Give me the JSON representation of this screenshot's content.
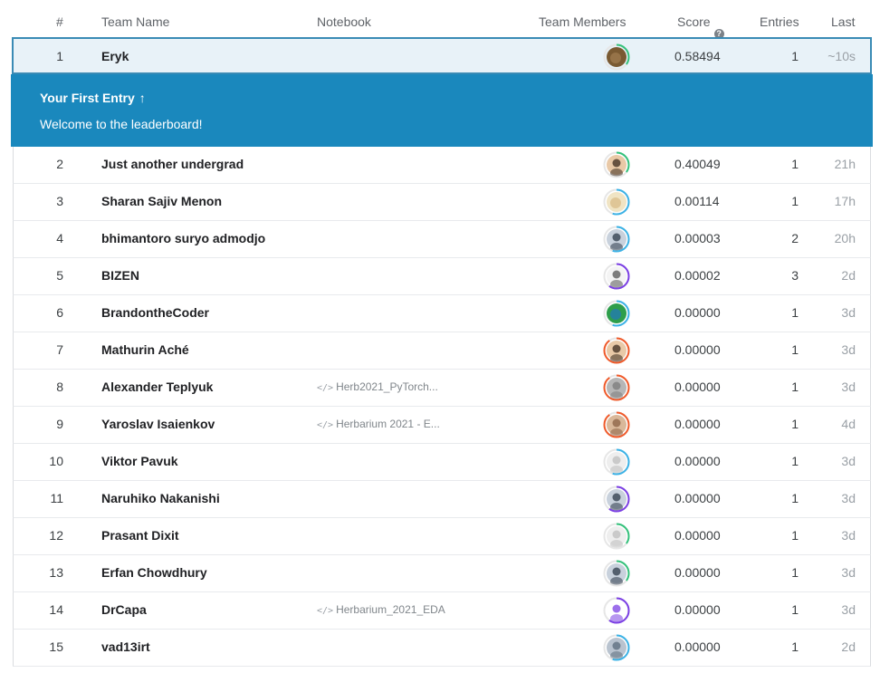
{
  "columns": {
    "rank": "#",
    "team": "Team Name",
    "notebook": "Notebook",
    "members": "Team Members",
    "score": "Score",
    "entries": "Entries",
    "last": "Last"
  },
  "banner": {
    "title": "Your First Entry",
    "message": "Welcome to the leaderboard!",
    "background": "#1a88bd"
  },
  "accent": {
    "green": "#34c17b",
    "blue": "#3bb2e6",
    "purple": "#7b3fe4",
    "orange": "#f05a2a",
    "highlight_border": "#3a8bb5",
    "highlight_bg": "#e8f2f8"
  },
  "rows": [
    {
      "rank": "1",
      "team": "Eryk",
      "notebook": "",
      "score": "0.58494",
      "entries": "1",
      "last": "~10s",
      "ring": "green",
      "avatar": "brown"
    },
    {
      "rank": "2",
      "team": "Just another undergrad",
      "notebook": "",
      "score": "0.40049",
      "entries": "1",
      "last": "21h",
      "ring": "green",
      "avatar": "person"
    },
    {
      "rank": "3",
      "team": "Sharan Sajiv Menon",
      "notebook": "",
      "score": "0.00114",
      "entries": "1",
      "last": "17h",
      "ring": "blue",
      "avatar": "sand"
    },
    {
      "rank": "4",
      "team": "bhimantoro suryo admodjo",
      "notebook": "",
      "score": "0.00003",
      "entries": "2",
      "last": "20h",
      "ring": "blue",
      "avatar": "person-dark"
    },
    {
      "rank": "5",
      "team": "BIZEN",
      "notebook": "",
      "score": "0.00002",
      "entries": "3",
      "last": "2d",
      "ring": "purple",
      "avatar": "person-light"
    },
    {
      "rank": "6",
      "team": "BrandontheCoder",
      "notebook": "",
      "score": "0.00000",
      "entries": "1",
      "last": "3d",
      "ring": "blue",
      "avatar": "green"
    },
    {
      "rank": "7",
      "team": "Mathurin Aché",
      "notebook": "",
      "score": "0.00000",
      "entries": "1",
      "last": "3d",
      "ring": "orange",
      "avatar": "person"
    },
    {
      "rank": "8",
      "team": "Alexander Teplyuk",
      "notebook": "Herb2021_PyTorch...",
      "score": "0.00000",
      "entries": "1",
      "last": "3d",
      "ring": "orange",
      "avatar": "grey"
    },
    {
      "rank": "9",
      "team": "Yaroslav Isaienkov",
      "notebook": "Herbarium 2021 - E...",
      "score": "0.00000",
      "entries": "1",
      "last": "4d",
      "ring": "orange",
      "avatar": "brown-light"
    },
    {
      "rank": "10",
      "team": "Viktor Pavuk",
      "notebook": "",
      "score": "0.00000",
      "entries": "1",
      "last": "3d",
      "ring": "blue",
      "avatar": "default"
    },
    {
      "rank": "11",
      "team": "Naruhiko Nakanishi",
      "notebook": "",
      "score": "0.00000",
      "entries": "1",
      "last": "3d",
      "ring": "purple",
      "avatar": "person-dark"
    },
    {
      "rank": "12",
      "team": "Prasant Dixit",
      "notebook": "",
      "score": "0.00000",
      "entries": "1",
      "last": "3d",
      "ring": "green",
      "avatar": "default"
    },
    {
      "rank": "13",
      "team": "Erfan Chowdhury",
      "notebook": "",
      "score": "0.00000",
      "entries": "1",
      "last": "3d",
      "ring": "green",
      "avatar": "person-dark"
    },
    {
      "rank": "14",
      "team": "DrCapa",
      "notebook": "Herbarium_2021_EDA",
      "score": "0.00000",
      "entries": "1",
      "last": "3d",
      "ring": "purple",
      "avatar": "logo"
    },
    {
      "rank": "15",
      "team": "vad13irt",
      "notebook": "",
      "score": "0.00000",
      "entries": "1",
      "last": "2d",
      "ring": "blue",
      "avatar": "grey-blue"
    }
  ]
}
